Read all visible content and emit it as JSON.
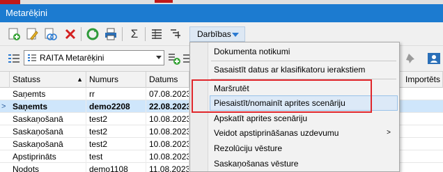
{
  "window": {
    "title": "Metarēķini"
  },
  "toolbar": {
    "icons": [
      "add-icon",
      "edit-icon",
      "copy-icon",
      "delete-icon",
      "refresh-icon",
      "print-icon",
      "sum-icon",
      "columns-icon",
      "sort-icon"
    ],
    "actions_label": "Darbības"
  },
  "filter": {
    "selected_view": "RAITA Metarēķini"
  },
  "table": {
    "columns": [
      "Statuss",
      "Numurs",
      "Datums",
      "Importēts"
    ],
    "rows": [
      {
        "status": "Saņemts",
        "number": "rr",
        "date": "07.08.2023.",
        "selected": false
      },
      {
        "status": "Saņemts",
        "number": "demo2208",
        "date": "22.08.2023.",
        "selected": true
      },
      {
        "status": "Saskaņošanā",
        "number": "test2",
        "date": "10.08.2023.",
        "selected": false
      },
      {
        "status": "Saskaņošanā",
        "number": "test2",
        "date": "10.08.2023.",
        "selected": false
      },
      {
        "status": "Saskaņošanā",
        "number": "test2",
        "date": "10.08.2023.",
        "selected": false
      },
      {
        "status": "Apstiprināts",
        "number": "test",
        "date": "10.08.2023.",
        "selected": false
      },
      {
        "status": "Nodots",
        "number": "demo1108",
        "date": "11.08.2023.",
        "selected": false
      }
    ]
  },
  "menu": {
    "items": [
      {
        "label": "Dokumenta notikumi"
      },
      {
        "label": "Sasaistīt datus ar klasifikatoru ierakstiem"
      },
      {
        "label": "Maršrutēt"
      },
      {
        "label": "Piesaistīt/nomainīt aprites scenāriju"
      },
      {
        "label": "Apskatīt aprites scenāriju"
      },
      {
        "label": "Veidot apstiprināšanas uzdevumu"
      },
      {
        "label": "Rezolūciju vēsture"
      },
      {
        "label": "Saskaņošanas vēsture"
      }
    ]
  },
  "colors": {
    "titlebar": "#1c7bd0",
    "selection": "#cfe6fb",
    "highlight_box": "#e0262b"
  }
}
